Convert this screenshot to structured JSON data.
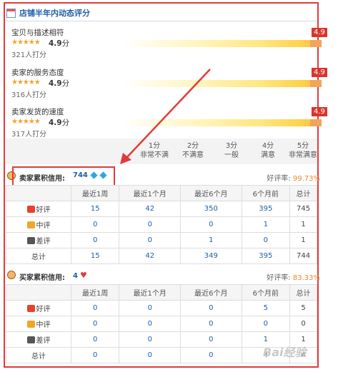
{
  "header": {
    "title": "店铺半年内动态评分",
    "icon": "calendar-icon"
  },
  "ratings": [
    {
      "label": "宝贝与描述相符",
      "stars": "★★★★★",
      "score": "4.9",
      "unit": "分",
      "count": "321人打分",
      "flag": "4.9"
    },
    {
      "label": "卖家的服务态度",
      "stars": "★★★★★",
      "score": "4.9",
      "unit": "分",
      "count": "316人打分",
      "flag": "4.9"
    },
    {
      "label": "卖家发货的速度",
      "stars": "★★★★★",
      "score": "4.9",
      "unit": "分",
      "count": "317人打分",
      "flag": "4.9"
    }
  ],
  "scale": [
    {
      "n": "1分",
      "t": "非常不满"
    },
    {
      "n": "2分",
      "t": "不满意"
    },
    {
      "n": "3分",
      "t": "一般"
    },
    {
      "n": "4分",
      "t": "满意"
    },
    {
      "n": "5分",
      "t": "非常满意"
    }
  ],
  "seller": {
    "label": "卖家累积信用:",
    "value": "744",
    "rate_label": "好评率:",
    "rate": "99.73%",
    "headers": [
      "最近1周",
      "最近1个月",
      "最近6个月",
      "6个月前",
      "总计"
    ],
    "rows": [
      {
        "label": "好评",
        "values": [
          "15",
          "42",
          "350",
          "395",
          "745"
        ]
      },
      {
        "label": "中评",
        "values": [
          "0",
          "0",
          "0",
          "1",
          "1"
        ]
      },
      {
        "label": "差评",
        "values": [
          "0",
          "0",
          "1",
          "0",
          "1"
        ]
      },
      {
        "label": "总计",
        "values": [
          "15",
          "42",
          "349",
          "395",
          "744"
        ]
      }
    ]
  },
  "buyer": {
    "label": "买家累积信用:",
    "value": "4",
    "rate_label": "好评率:",
    "rate": "83.33%",
    "headers": [
      "最近1周",
      "最近1个月",
      "最近6个月",
      "6个月前",
      "总计"
    ],
    "rows": [
      {
        "label": "好评",
        "values": [
          "0",
          "0",
          "0",
          "5",
          "5"
        ]
      },
      {
        "label": "中评",
        "values": [
          "0",
          "0",
          "0",
          "0",
          "0"
        ]
      },
      {
        "label": "差评",
        "values": [
          "0",
          "0",
          "0",
          "1",
          "1"
        ]
      },
      {
        "label": "总计",
        "values": [
          "0",
          "0",
          "0",
          "4",
          "4"
        ]
      }
    ]
  },
  "watermark": "Bai经验",
  "colors": {
    "accent_red": "#e33a3a",
    "link_blue": "#1f5fa8",
    "rate_orange": "#f0862a"
  }
}
